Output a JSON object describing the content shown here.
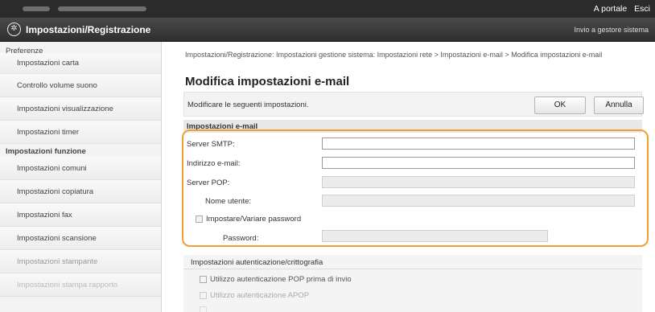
{
  "topbar": {
    "portal_link": "A portale",
    "exit_link": "Esci"
  },
  "titlebar": {
    "title": "Impostazioni/Registrazione",
    "right_link": "Invio a gestore sistema"
  },
  "sidebar": {
    "section1": "Preferenze",
    "items1": [
      "Impostazioni carta",
      "Controllo volume suono",
      "Impostazioni visualizzazione",
      "Impostazioni timer"
    ],
    "section2": "Impostazioni funzione",
    "items2": [
      "Impostazioni comuni",
      "Impostazioni copiatura",
      "Impostazioni fax",
      "Impostazioni scansione",
      "Impostazioni stampante",
      "Impostazioni stampa rapporto"
    ]
  },
  "main": {
    "breadcrumb": "Impostazioni/Registrazione: Impostazioni gestione sistema: Impostazioni rete > Impostazioni e-mail > Modifica impostazioni e-mail",
    "page_title": "Modifica impostazioni e-mail",
    "description": "Modificare le seguenti impostazioni.",
    "ok_label": "OK",
    "cancel_label": "Annulla",
    "section_email": "Impostazioni e-mail",
    "smtp_label": "Server SMTP:",
    "smtp_value": "",
    "email_label": "Indirizzo e-mail:",
    "email_value": "",
    "pop_label": "Server POP:",
    "pop_value": "",
    "username_label": "Nome utente:",
    "username_value": "",
    "set_password_label": "Impostare/Variare password",
    "password_label": "Password:",
    "password_value": "",
    "section_auth": "Impostazioni autenticazione/crittografia",
    "pop_before_send": "Utilizzo autenticazione POP prima di invio",
    "apop": "Utilizzo autenticazione APOP"
  },
  "colors": {
    "highlight": "#f0a030",
    "titlebar": "#3a3a3a"
  }
}
